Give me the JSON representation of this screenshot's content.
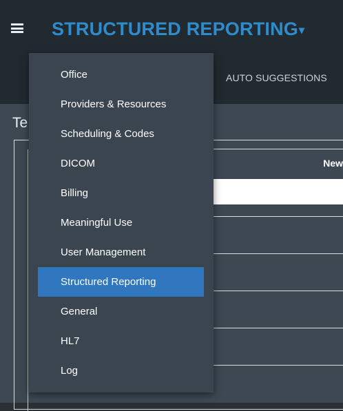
{
  "header": {
    "app_title": "STRUCTURED REPORTING",
    "caret": "▾"
  },
  "tabs": [
    {
      "label": "AUTO SUGGESTIONS"
    }
  ],
  "content": {
    "title": "Te",
    "column_header": "New"
  },
  "dropdown_menu": {
    "active_index": 7,
    "items": [
      {
        "label": "Office"
      },
      {
        "label": "Providers & Resources"
      },
      {
        "label": "Scheduling & Codes"
      },
      {
        "label": "DICOM"
      },
      {
        "label": "Billing"
      },
      {
        "label": "Meaningful Use"
      },
      {
        "label": "User Management"
      },
      {
        "label": "Structured Reporting"
      },
      {
        "label": "General"
      },
      {
        "label": "HL7"
      },
      {
        "label": "Log"
      }
    ]
  },
  "colors": {
    "accent": "#2f8ccc",
    "active_item": "#3077c0",
    "topbar": "#212a31",
    "content_bg": "#3d4852",
    "menu_bg": "#3a454f"
  }
}
